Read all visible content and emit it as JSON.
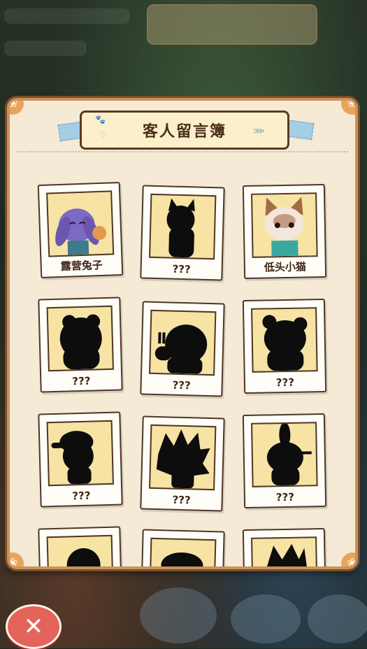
{
  "panel": {
    "title": "客人留言簿"
  },
  "guests": [
    {
      "name": "露营兔子",
      "locked": false,
      "icon": "bunny-portrait"
    },
    {
      "name": "???",
      "locked": true,
      "icon": "cat-silhouette"
    },
    {
      "name": "低头小猫",
      "locked": false,
      "icon": "cat-portrait"
    },
    {
      "name": "???",
      "locked": true,
      "icon": "fluffy-silhouette"
    },
    {
      "name": "???",
      "locked": true,
      "icon": "pig-silhouette"
    },
    {
      "name": "???",
      "locked": true,
      "icon": "bear-silhouette"
    },
    {
      "name": "???",
      "locked": true,
      "icon": "capped-silhouette"
    },
    {
      "name": "???",
      "locked": true,
      "icon": "spiky-silhouette"
    },
    {
      "name": "???",
      "locked": true,
      "icon": "rabbit-silhouette"
    },
    {
      "name": "",
      "locked": true,
      "icon": "partial-silhouette"
    },
    {
      "name": "",
      "locked": true,
      "icon": "partial-silhouette"
    },
    {
      "name": "",
      "locked": true,
      "icon": "partial-silhouette"
    }
  ],
  "colors": {
    "panel_bg": "#f5ead6",
    "panel_border": "#c9935a",
    "photo_bg": "#f7e3a3",
    "close_button": "#e4635a"
  },
  "close_button": {
    "icon": "close-icon",
    "glyph": "✕"
  }
}
